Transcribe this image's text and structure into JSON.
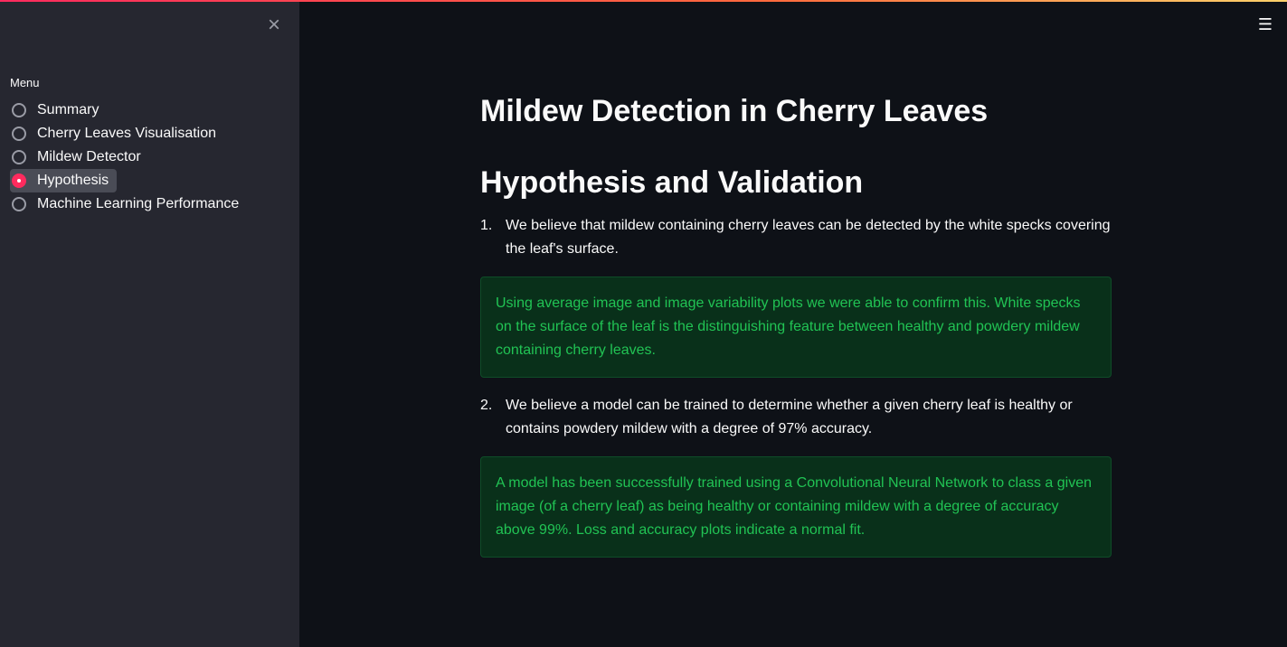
{
  "sidebar": {
    "close_icon": "×",
    "menu_label": "Menu",
    "items": [
      {
        "label": "Summary"
      },
      {
        "label": "Cherry Leaves Visualisation"
      },
      {
        "label": "Mildew Detector"
      },
      {
        "label": "Hypothesis"
      },
      {
        "label": "Machine Learning Performance"
      }
    ],
    "selected_index": 3
  },
  "header": {
    "menu_icon": "☰"
  },
  "main": {
    "title": "Mildew Detection in Cherry Leaves",
    "subtitle": "Hypothesis and Validation",
    "hypotheses": [
      {
        "number": "1.",
        "text": "We believe that mildew containing cherry leaves can be detected by the white specks covering the leaf's surface.",
        "result": "Using average image and image variability plots we were able to confirm this. White specks on the surface of the leaf is the distinguishing feature between healthy and powdery mildew containing cherry leaves."
      },
      {
        "number": "2.",
        "text": "We believe a model can be trained to determine whether a given cherry leaf is healthy or contains powdery mildew with a degree of 97% accuracy.",
        "result": "A model has been successfully trained using a Convolutional Neural Network to class a given image (of a cherry leaf) as being healthy or containing mildew with a degree of accuracy above 99%. Loss and accuracy plots indicate a normal fit."
      }
    ]
  },
  "colors": {
    "accent": "#ff2b5e",
    "sidebar_bg": "#262730",
    "main_bg": "#0e1117",
    "success_bg": "#09301a",
    "success_text": "#21c354"
  }
}
